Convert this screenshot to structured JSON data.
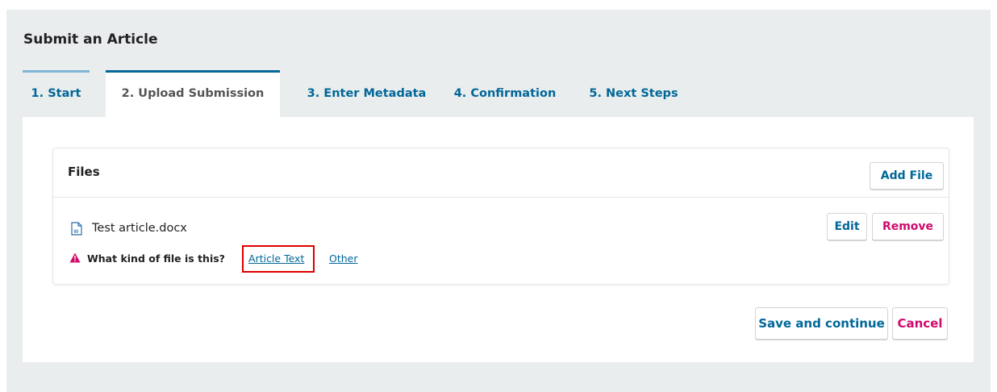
{
  "page": {
    "title": "Submit an Article"
  },
  "tabs": [
    {
      "label": "1. Start"
    },
    {
      "label": "2. Upload Submission"
    },
    {
      "label": "3. Enter Metadata"
    },
    {
      "label": "4. Confirmation"
    },
    {
      "label": "5. Next Steps"
    }
  ],
  "files": {
    "title": "Files",
    "add_label": "Add File",
    "items": [
      {
        "icon": "word-document-icon",
        "name": "Test article.docx",
        "edit_label": "Edit",
        "remove_label": "Remove",
        "warning_icon": "warning-triangle-icon",
        "question": "What kind of file is this?",
        "options": [
          "Article Text",
          "Other"
        ]
      }
    ]
  },
  "actions": {
    "save_label": "Save and continue",
    "cancel_label": "Cancel"
  },
  "colors": {
    "accent": "#006798",
    "danger": "#d00a6c",
    "highlight": "#e00000",
    "background": "#eaedee"
  }
}
